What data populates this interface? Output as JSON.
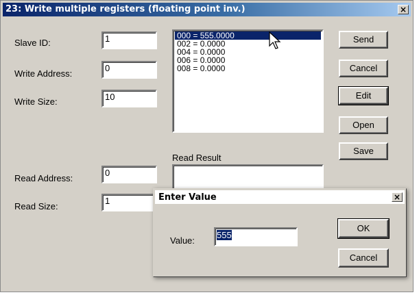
{
  "window": {
    "title": "23: Write multiple registers (floating point inv.)",
    "close_glyph": "×"
  },
  "form": {
    "slave_id": {
      "label": "Slave ID:",
      "value": "1"
    },
    "write_address": {
      "label": "Write Address:",
      "value": "0"
    },
    "write_size": {
      "label": "Write Size:",
      "value": "10"
    },
    "read_address": {
      "label": "Read Address:",
      "value": "0"
    },
    "read_size": {
      "label": "Read Size:",
      "value": "1"
    },
    "read_result_label": "Read Result",
    "read_result_value": ""
  },
  "register_list": [
    "000 = 555.0000",
    "002 = 0.0000",
    "004 = 0.0000",
    "006 = 0.0000",
    "008 = 0.0000"
  ],
  "buttons": {
    "send": "Send",
    "cancel": "Cancel",
    "edit": "Edit",
    "open": "Open",
    "save": "Save"
  },
  "dialog": {
    "title": "Enter Value",
    "close_glyph": "×",
    "value_label": "Value:",
    "value": "555",
    "ok": "OK",
    "cancel": "Cancel"
  },
  "colors": {
    "title_gradient_start": "#0a246a",
    "title_gradient_end": "#a6caf0",
    "selection": "#0a246a",
    "face": "#d4d0c8"
  },
  "icons": {
    "cursor": "mouse-pointer-icon",
    "close": "close-icon"
  }
}
